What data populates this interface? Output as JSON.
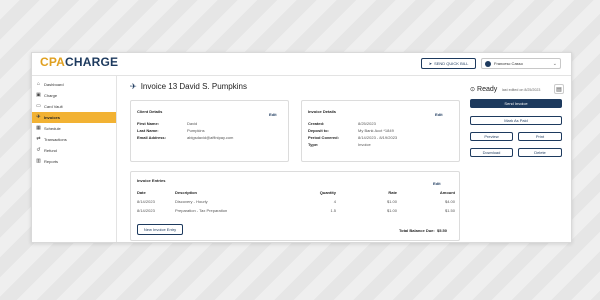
{
  "header": {
    "logo_cpa": "CPA",
    "logo_charge": "CHARGE",
    "logo_sub": "",
    "quick_bill": "SEND QUICK BILL",
    "user_name": "Francesc Casso"
  },
  "sidebar": {
    "items": [
      {
        "label": "Dashboard",
        "icon": "home-icon"
      },
      {
        "label": "Charge",
        "icon": "charge-icon"
      },
      {
        "label": "Card Vault",
        "icon": "card-icon"
      },
      {
        "label": "Invoices",
        "icon": "invoice-icon"
      },
      {
        "label": "Schedule",
        "icon": "calendar-icon"
      },
      {
        "label": "Transactions",
        "icon": "transfer-icon"
      },
      {
        "label": "Refund",
        "icon": "refund-icon"
      },
      {
        "label": "Reports",
        "icon": "chart-icon"
      }
    ],
    "active": "Invoices"
  },
  "page": {
    "title": "Invoice 13 David S. Pumpkins"
  },
  "client": {
    "title": "Client Details",
    "edit": "Edit",
    "first_name_label": "First Name:",
    "first_name": "David",
    "last_name_label": "Last Name:",
    "last_name": "Pumpkins",
    "email_label": "Email Address:",
    "email": "abigsdavid@affinipay.com"
  },
  "invoice_details": {
    "title": "Invoice Details",
    "edit": "Edit",
    "created_label": "Created:",
    "created": "8/25/2023",
    "deposit_label": "Deposit to:",
    "deposit": "My Bank Acct *1849",
    "period_label": "Period Covered:",
    "period": "8/14/2023 - 8/19/2023",
    "type_label": "Type:",
    "type": "Invoice"
  },
  "entries": {
    "title": "Invoice Entries",
    "edit": "Edit",
    "columns": {
      "date": "Date",
      "description": "Description",
      "quantity": "Quantity",
      "rate": "Rate",
      "amount": "Amount"
    },
    "rows": [
      {
        "date": "8/14/2023",
        "description": "Discovery - Hourly",
        "quantity": "4",
        "rate": "$1.00",
        "amount": "$4.00"
      },
      {
        "date": "8/14/2023",
        "description": "Preparation - Tax Preparation",
        "quantity": "1.5",
        "rate": "$1.00",
        "amount": "$1.50"
      }
    ],
    "new_entry": "New Invoice Entry",
    "balance_label": "Total Balance Due:",
    "balance": "$5.50"
  },
  "status": {
    "label": "Ready",
    "sub": "last edited on 8/25/2023"
  },
  "actions": {
    "send": "Send Invoice",
    "mark_paid": "Mark As Paid",
    "preview": "Preview",
    "print": "Print",
    "download": "Download",
    "delete": "Delete"
  },
  "colors": {
    "brand_navy": "#1d3a5e",
    "brand_gold": "#f2b233"
  }
}
